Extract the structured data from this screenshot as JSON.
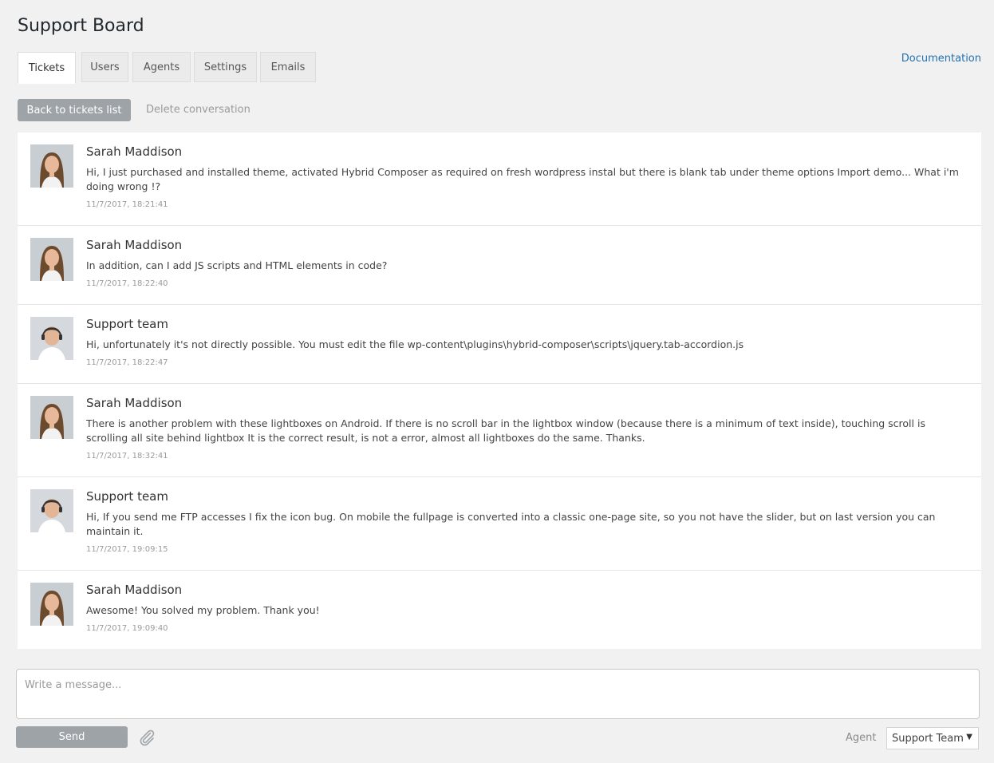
{
  "app": {
    "title": "Support Board",
    "documentation_label": "Documentation"
  },
  "tabs": [
    {
      "label": "Tickets",
      "active": true
    },
    {
      "label": "Users",
      "active": false
    },
    {
      "label": "Agents",
      "active": false
    },
    {
      "label": "Settings",
      "active": false
    },
    {
      "label": "Emails",
      "active": false
    }
  ],
  "toolbar": {
    "back_label": "Back to tickets list",
    "delete_label": "Delete conversation"
  },
  "messages": [
    {
      "author": "Sarah Maddison",
      "role": "user",
      "text": "Hi, I just purchased and installed theme, activated Hybrid Composer as required on fresh wordpress instal but there is blank tab under theme options Import demo... What i'm doing wrong !?",
      "time": "11/7/2017, 18:21:41"
    },
    {
      "author": "Sarah Maddison",
      "role": "user",
      "text": "In addition, can I add JS scripts and HTML elements in code?",
      "time": "11/7/2017, 18:22:40"
    },
    {
      "author": "Support team",
      "role": "agent",
      "text": "Hi, unfortunately it's not directly possible. You must edit the file wp-content\\plugins\\hybrid-composer\\scripts\\jquery.tab-accordion.js",
      "time": "11/7/2017, 18:22:47"
    },
    {
      "author": "Sarah Maddison",
      "role": "user",
      "text": "There is another problem with these lightboxes on Android. If there is no scroll bar in the lightbox window (because there is a minimum of text inside), touching scroll is scrolling all site behind lightbox It is the correct result, is not a error, almost all lightboxes do the same. Thanks.",
      "time": "11/7/2017, 18:32:41"
    },
    {
      "author": "Support team",
      "role": "agent",
      "text": "Hi, If you send me FTP accesses I fix the icon bug. On mobile the fullpage is converted into a classic one-page site, so you not have the slider, but on last version you can maintain it.",
      "time": "11/7/2017, 19:09:15"
    },
    {
      "author": "Sarah Maddison",
      "role": "user",
      "text": "Awesome! You solved my problem. Thank you!",
      "time": "11/7/2017, 19:09:40"
    }
  ],
  "composer": {
    "placeholder": "Write a message...",
    "send_label": "Send",
    "agent_label": "Agent",
    "agent_selected": "Support Team",
    "agent_arrow": "▼"
  },
  "colors": {
    "accent_link": "#2271b1",
    "button_gray": "#9ea3a8",
    "background": "#f1f1f1"
  }
}
